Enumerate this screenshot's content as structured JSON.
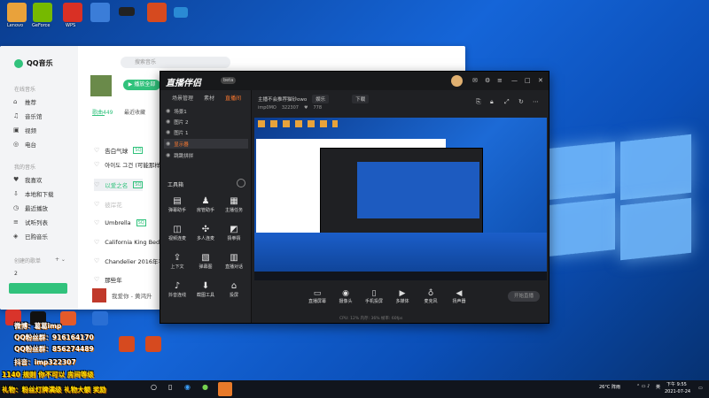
{
  "desktop": {
    "icons": [
      {
        "label": "Lenovo",
        "color": "#e9a23b"
      },
      {
        "label": "GeForce",
        "color": "#76b900"
      },
      {
        "label": "WPS",
        "color": "#d93025"
      },
      {
        "label": "",
        "color": "#3b7dd8"
      },
      {
        "label": "",
        "color": "#222222"
      },
      {
        "label": "",
        "color": "#d64a1f"
      },
      {
        "label": "",
        "color": "#2a8ad4"
      }
    ],
    "overlay_lines": [
      "微博：葛葛imp",
      "QQ粉丝群：916164170",
      "QQ粉丝群：856274489",
      "抖音：imp322307",
      "1140 规则 你不可以 房间等级",
      "礼物：粉丝灯牌满级 礼物大额 奖励"
    ]
  },
  "qq_music": {
    "brand": "QQ音乐",
    "search_placeholder": "搜索音乐",
    "sections": [
      {
        "title": "在线音乐",
        "items": [
          "推荐",
          "音乐馆",
          "视频",
          "电台"
        ]
      },
      {
        "title": "我的音乐",
        "items": [
          "我喜欢",
          "本地和下载",
          "最近播放",
          "试听列表",
          "已购音乐"
        ]
      }
    ],
    "playlist_header": "创建的歌单",
    "playlist_count": "2",
    "play_all": "播放全部",
    "tabs": [
      "歌曲449",
      "最近收藏"
    ],
    "songs": [
      {
        "title": "告白气球"
      },
      {
        "title": "아이도 그건 (可能那样)"
      },
      {
        "title": "以爱之名"
      },
      {
        "title": "彼岸花"
      },
      {
        "title": "Umbrella"
      },
      {
        "title": "California King Bed (Al..."
      },
      {
        "title": "Chandelier 2016年平安"
      },
      {
        "title": "那些年"
      },
      {
        "title": "我爱你 - 黄鸿升"
      }
    ]
  },
  "streamer_app": {
    "title": "直播伴侣",
    "version": "beta",
    "tabs": [
      "场景管理",
      "素材",
      "直播间"
    ],
    "info": {
      "room_title": "主播不会推荐猫砂owo",
      "category": "娱乐",
      "area": "下载",
      "user": "imp0MO",
      "id": "322307",
      "likes": "778"
    },
    "scenes": [
      {
        "label": "场景1"
      },
      {
        "label": "图片 2"
      },
      {
        "label": "图片 1"
      },
      {
        "label": "显示器"
      },
      {
        "label": "跳跳拼拼"
      }
    ],
    "tools_title": "工具箱",
    "tools": [
      "弹幕助手",
      "房管助手",
      "主播任务",
      "视频连麦",
      "多人连麦",
      "猜拳猜",
      "上下文",
      "弹幕图",
      "直播对话",
      "抖音连线",
      "截图工具",
      "投屏"
    ],
    "bottom_buttons": [
      "直播屏幕",
      "摄像头",
      "手机投屏",
      "多媒体",
      "麦克风",
      "扬声器"
    ],
    "live_button": "开始直播",
    "status": "CPU: 12%  内存: 36%  帧率: 60fps"
  },
  "taskbar": {
    "weather": "26°C 阵雨",
    "time": "下午 9:55",
    "date": "2021-07-24",
    "lang": "英"
  }
}
